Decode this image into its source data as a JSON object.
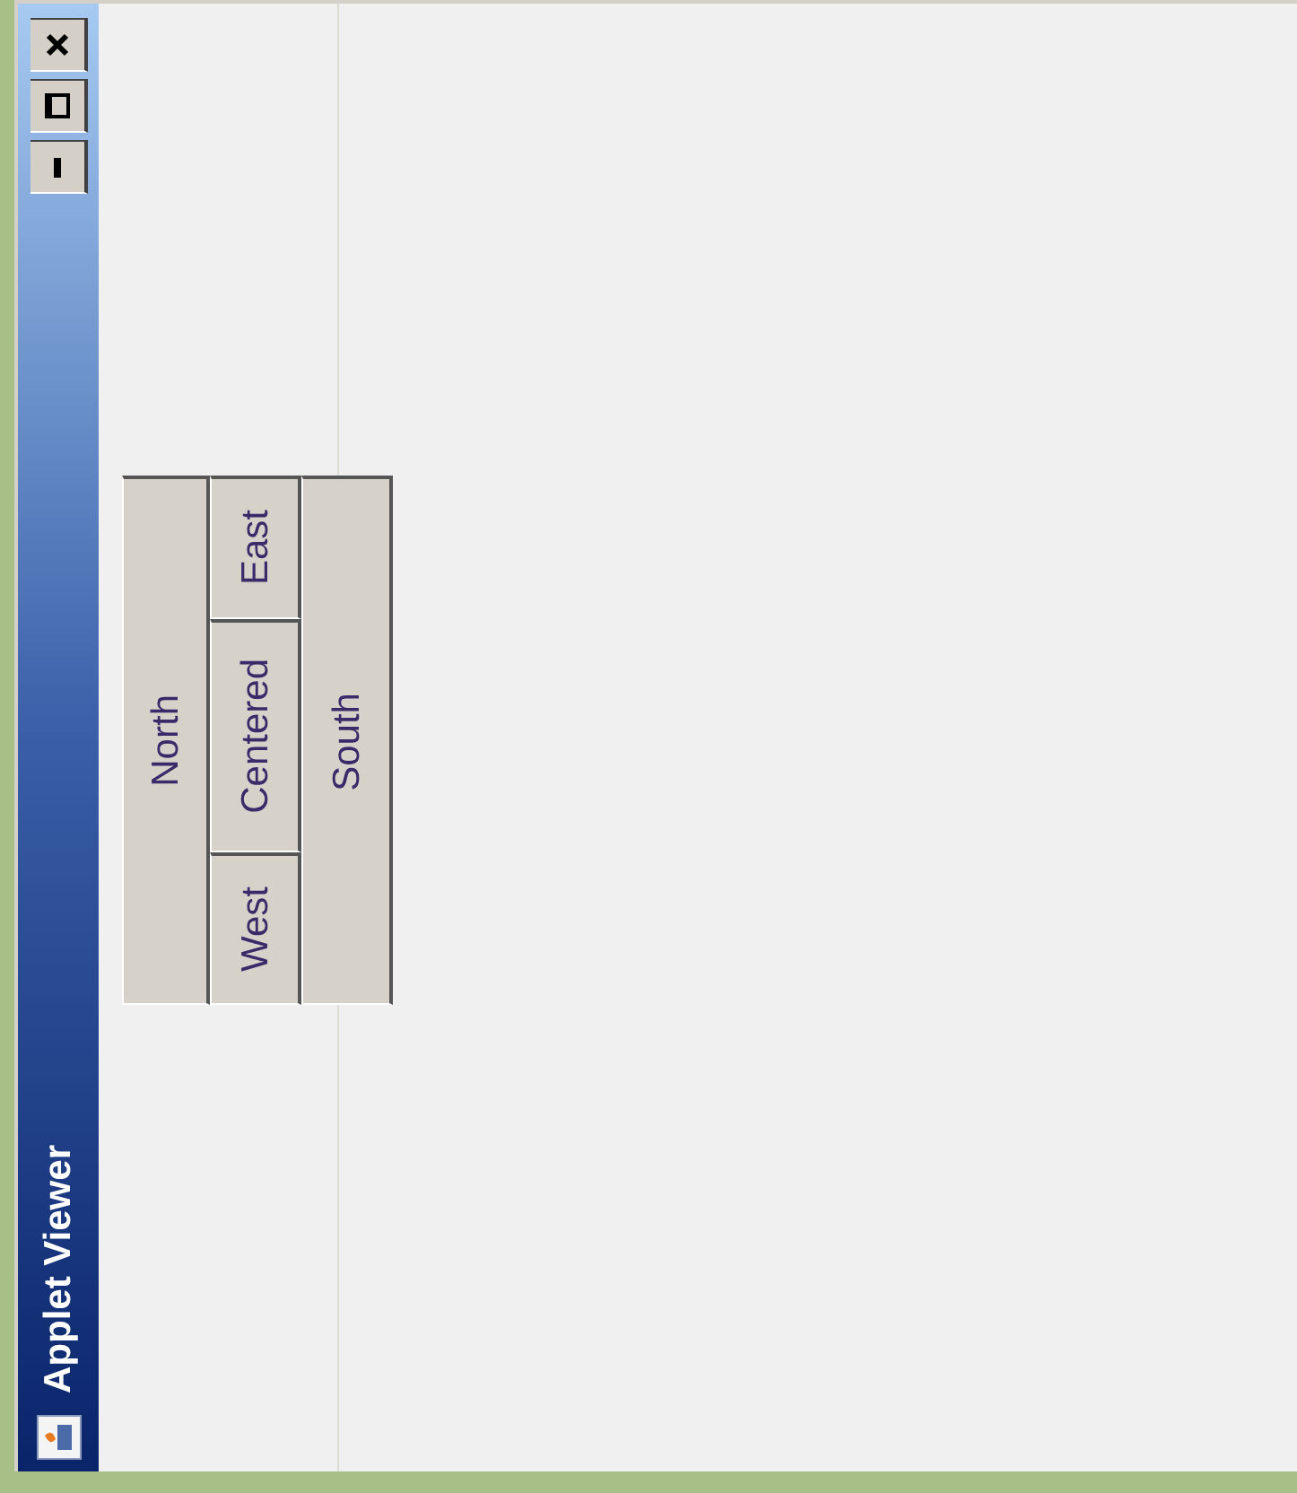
{
  "window": {
    "title": "Applet Viewer"
  },
  "buttons": [
    {
      "label": "North",
      "kind": "north"
    },
    {
      "label": "East",
      "kind": "east"
    },
    {
      "label": "Centered",
      "kind": "center"
    },
    {
      "label": "West",
      "kind": "west"
    },
    {
      "label": "South",
      "kind": "south"
    }
  ]
}
